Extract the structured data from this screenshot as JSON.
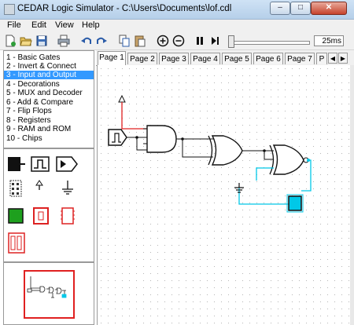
{
  "window": {
    "title": "CEDAR Logic Simulator - C:\\Users\\Documents\\lof.cdl",
    "minimize_glyph": "–",
    "maximize_glyph": "□",
    "close_glyph": "✕"
  },
  "menu": [
    "File",
    "Edit",
    "View",
    "Help"
  ],
  "toolbar": {
    "icons": [
      "new-file-icon",
      "open-file-icon",
      "save-icon",
      "print-icon",
      "undo-icon",
      "redo-icon",
      "copy-icon",
      "paste-icon",
      "zoom-in-icon",
      "zoom-out-icon",
      "pause-icon",
      "step-icon"
    ],
    "speed_value": "25ms",
    "speed_level": 0.02
  },
  "categories": [
    "1 - Basic Gates",
    "2 - Invert & Connect",
    "3 - Input and Output",
    "4 - Decorations",
    "5 - MUX and Decoder",
    "6 - Add & Compare",
    "7 - Flip Flops",
    "8 - Registers",
    "9 - RAM and ROM",
    "10 - Chips"
  ],
  "selected_category_index": 2,
  "palette_items": [
    "toggle-switch-icon",
    "pulse-icon",
    "output-port-icon",
    "keypad-icon",
    "input-arrow-icon",
    "ground-icon",
    "led-box-icon",
    "seven-segment-icon",
    "hex-display-icon",
    "dual-display-icon"
  ],
  "tabs": [
    "Page 1",
    "Page 2",
    "Page 3",
    "Page 4",
    "Page 5",
    "Page 6",
    "Page 7",
    "P"
  ],
  "active_tab_index": 0,
  "colors": {
    "selection": "#3399ff",
    "wire_high": "#e02020",
    "wire_selected": "#00c8e8",
    "wire_low": "#000000",
    "preview_border": "#e02020"
  }
}
